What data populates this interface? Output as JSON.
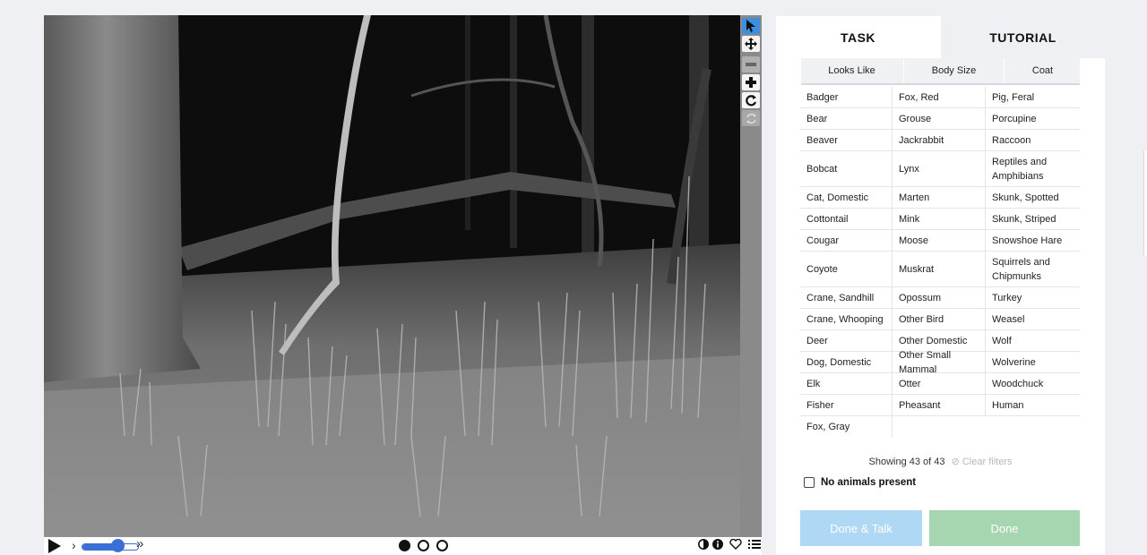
{
  "colors": {
    "accent": "#3b8fde",
    "slider": "#3b6fd8",
    "done_talk_bg": "#aed8f3",
    "done_bg": "#a5d6b0",
    "tutorial_tab_bg": "#eef0f3"
  },
  "viewer": {
    "image_description_icon": "trail-camera-photo",
    "tools": [
      {
        "name": "pointer",
        "icon": "pointer-icon",
        "active": true
      },
      {
        "name": "pan",
        "icon": "move-icon",
        "active": false
      },
      {
        "name": "zoom-out",
        "icon": "minus-icon",
        "active": false
      },
      {
        "name": "zoom-in",
        "icon": "plus-icon",
        "active": false
      },
      {
        "name": "rotate",
        "icon": "rotate-icon",
        "active": false
      },
      {
        "name": "reset",
        "icon": "reset-icon",
        "active": false
      }
    ],
    "controls": {
      "speed_min_label": "›",
      "speed_max_label": "»",
      "speed_level": 0.65,
      "frames": 3,
      "current_frame": 1
    }
  },
  "panel": {
    "tabs": {
      "task": "TASK",
      "tutorial": "TUTORIAL"
    },
    "filters": {
      "looks_like": "Looks Like",
      "body_size": "Body Size",
      "coat": "Coat"
    },
    "species_rows": [
      [
        "Badger",
        "Fox, Red",
        "Pig, Feral"
      ],
      [
        "Bear",
        "Grouse",
        "Porcupine"
      ],
      [
        "Beaver",
        "Jackrabbit",
        "Raccoon"
      ],
      [
        "Bobcat",
        "Lynx",
        "Reptiles and Amphibians"
      ],
      [
        "Cat, Domestic",
        "Marten",
        "Skunk, Spotted"
      ],
      [
        "Cottontail",
        "Mink",
        "Skunk, Striped"
      ],
      [
        "Cougar",
        "Moose",
        "Snowshoe Hare"
      ],
      [
        "Coyote",
        "Muskrat",
        "Squirrels and Chipmunks"
      ],
      [
        "Crane, Sandhill",
        "Opossum",
        "Turkey"
      ],
      [
        "Crane, Whooping",
        "Other Bird",
        "Weasel"
      ],
      [
        "Deer",
        "Other Domestic",
        "Wolf"
      ],
      [
        "Dog, Domestic",
        "Other Small Mammal",
        "Wolverine"
      ],
      [
        "Elk",
        "Otter",
        "Woodchuck"
      ],
      [
        "Fisher",
        "Pheasant",
        "Human"
      ],
      [
        "Fox, Gray",
        "",
        ""
      ]
    ],
    "showing": "Showing 43 of 43",
    "clear_filters": "Clear filters",
    "no_animals": "No animals present",
    "done_talk": "Done & Talk",
    "done": "Done"
  }
}
